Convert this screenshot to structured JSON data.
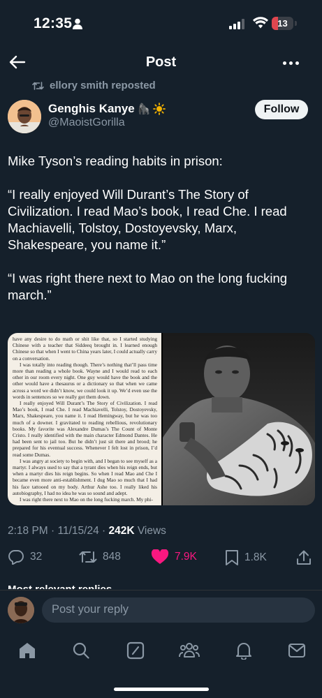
{
  "status_bar": {
    "time": "12:35",
    "battery": "13"
  },
  "header": {
    "title": "Post"
  },
  "repost": {
    "label": "ellory smith reposted"
  },
  "author": {
    "name": "Genghis Kanye",
    "emoji": "🦍",
    "handle": "@MaoistGorilla",
    "follow_label": "Follow"
  },
  "tweet": {
    "paragraphs": [
      "Mike Tyson’s reading habits in prison:",
      "“I really enjoyed Will Durant’s The Story of Civilization. I read Mao’s book, I read Che. I read Machiavelli, Tolstoy, Dostoyevsky, Marx, Shakespeare, you name it.”",
      "“I was right there next to Mao on the long fucking march.”"
    ]
  },
  "book_page": {
    "paragraphs": [
      "have any desire to do math or shit like that, so I started studying Chinese with a teacher that Siddeeq brought in. I learned enough Chinese so that when I went to China years later, I could actually carry on a conversation.",
      "I was totally into reading though. There’s nothing that’ll pass time more than reading a whole book. Wayne and I would read to each other in our room every night. One guy would have the book and the other would have a thesaurus or a dictionary so that when we came across a word we didn’t know, we could look it up. We’d even use the words in sentences so we really got them down.",
      "I really enjoyed Will Durant’s The Story of Civilization. I read Mao’s book, I read Che. I read Machiavelli, Tolstoy, Dostoyevsky, Marx, Shakespeare, you name it. I read Hemingway, but he was too much of a downer. I gravitated to reading rebellious, revolutionary books. My favorite was Alexandre Dumas’s The Count of Monte Cristo. I really identified with the main character Edmond Dantes. He had been sent to jail too. But he didn’t just sit there and brood; he prepared for his eventual success. Whenever I felt lost in prison, I’d read some Dumas.",
      "I was angry at society to begin with, and I began to see myself as a martyr. I always used to say that a tyrant dies when his reign ends, but when a martyr dies his reign begins. So when I read Mao and Che I became even more anti-establishment. I dug Mao so much that I had his face tattooed on my body. Arthur Ashe too. I really liked his autobiography, I had no idea he was so sound and adept.",
      "I was right there next to Mao on the long fucking march. My phi-"
    ]
  },
  "meta": {
    "time_date": "2:18 PM · 11/15/24 · ",
    "views_count": "242K",
    "views_label": " Views"
  },
  "actions": {
    "replies": "32",
    "reposts": "848",
    "likes": "7.9K",
    "bookmarks": "1.8K"
  },
  "more_replies": "Most relevant replies",
  "reply": {
    "placeholder": "Post your reply"
  },
  "colors": {
    "background": "#15202b",
    "like": "#f91880",
    "muted": "#8b98a5"
  },
  "icons": [
    "back-arrow-icon",
    "more-icon",
    "repost-icon",
    "reply-icon",
    "like-icon",
    "bookmark-icon",
    "share-icon",
    "home-icon",
    "search-icon",
    "grok-icon",
    "communities-icon",
    "notifications-icon",
    "messages-icon"
  ]
}
